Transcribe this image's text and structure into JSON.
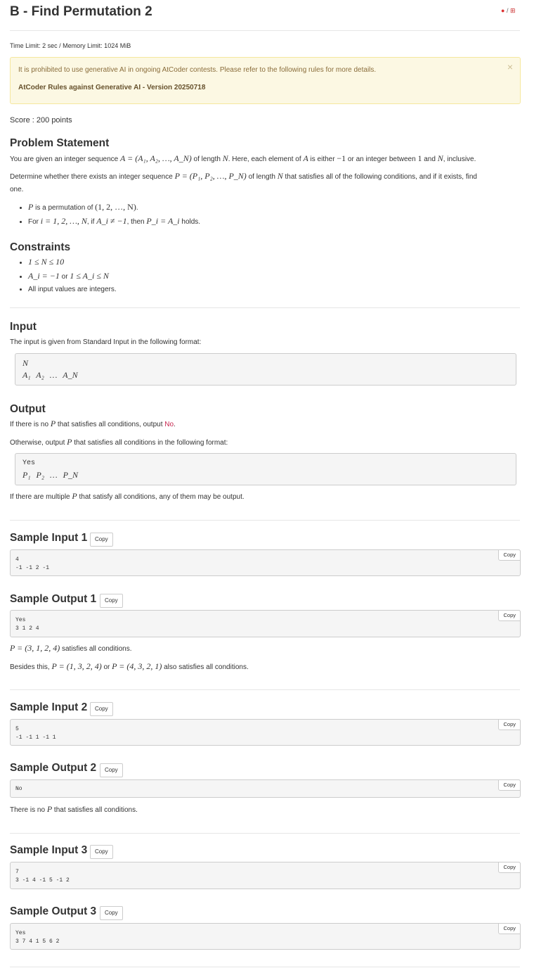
{
  "header": {
    "title": "B - Find Permutation 2",
    "lang_sep": "/"
  },
  "limits": "Time Limit: 2 sec / Memory Limit: 1024 MiB",
  "alert": {
    "message": "It is prohibited to use generative AI in ongoing AtCoder contests. Please refer to the following rules for more details.",
    "rule_link": "AtCoder Rules against Generative AI - Version 20250718",
    "close": "×"
  },
  "score": "Score : 200 points",
  "statement": {
    "heading": "Problem Statement",
    "p1_a": "You are given an integer sequence ",
    "p1_m1": "A = (A₁, A₂, …, A_N)",
    "p1_b": " of length ",
    "p1_m2": "N",
    "p1_c": ". Here, each element of ",
    "p1_m3": "A",
    "p1_d": " is either ",
    "p1_m4": "−1",
    "p1_e": " or an integer between ",
    "p1_m5": "1",
    "p1_f": " and ",
    "p1_m6": "N",
    "p1_g": ", inclusive.",
    "p2_a": "Determine whether there exists an integer sequence ",
    "p2_m1": "P = (P₁, P₂, …, P_N)",
    "p2_b": " of length ",
    "p2_m2": "N",
    "p2_c": " that satisfies all of the following conditions, and if it exists, find",
    "p2_d": "one.",
    "b1_m1": "P",
    "b1_a": " is a permutation of ",
    "b1_m2": "(1, 2, …, N)",
    "b1_b": ".",
    "b2_a": "For ",
    "b2_m1": "i = 1, 2, …, N",
    "b2_b": ", if ",
    "b2_m2": "A_i ≠ −1",
    "b2_c": ", then ",
    "b2_m3": "P_i = A_i",
    "b2_d": " holds."
  },
  "constraints": {
    "heading": "Constraints",
    "c1": "1 ≤ N ≤ 10",
    "c2_m1": "A_i = −1",
    "c2_a": " or ",
    "c2_m2": "1 ≤ A_i ≤ N",
    "c3": "All input values are integers."
  },
  "input": {
    "heading": "Input",
    "desc": "The input is given from Standard Input in the following format:",
    "line1": "N",
    "line2": "A₁ A₂ … A_N"
  },
  "output": {
    "heading": "Output",
    "p1_a": "If there is no ",
    "p1_m": "P",
    "p1_b": " that satisfies all conditions, output ",
    "p1_code": "No",
    "p1_c": ".",
    "p2_a": "Otherwise, output ",
    "p2_m": "P",
    "p2_b": " that satisfies all conditions in the following format:",
    "fmt_yes": "Yes",
    "fmt_line": "P₁ P₂ … P_N",
    "p3_a": "If there are multiple ",
    "p3_m": "P",
    "p3_b": " that satisfy all conditions, any of them may be output."
  },
  "copy_label": "Copy",
  "samples": {
    "in1": {
      "heading": "Sample Input 1",
      "code": "4\n-1 -1 2 -1"
    },
    "out1": {
      "heading": "Sample Output 1",
      "code": "Yes\n3 1 2 4"
    },
    "exp1_a_m": "P = (3, 1, 2, 4)",
    "exp1_a": " satisfies all conditions.",
    "exp1_b_pre": "Besides this, ",
    "exp1_b_m1": "P = (1, 3, 2, 4)",
    "exp1_b_or": " or ",
    "exp1_b_m2": "P = (4, 3, 2, 1)",
    "exp1_b_post": " also satisfies all conditions.",
    "in2": {
      "heading": "Sample Input 2",
      "code": "5\n-1 -1 1 -1 1"
    },
    "out2": {
      "heading": "Sample Output 2",
      "code": "No"
    },
    "exp2_pre": "There is no ",
    "exp2_m": "P",
    "exp2_post": " that satisfies all conditions.",
    "in3": {
      "heading": "Sample Input 3",
      "code": "7\n3 -1 4 -1 5 -1 2"
    },
    "out3": {
      "heading": "Sample Output 3",
      "code": "Yes\n3 7 4 1 5 6 2"
    }
  }
}
